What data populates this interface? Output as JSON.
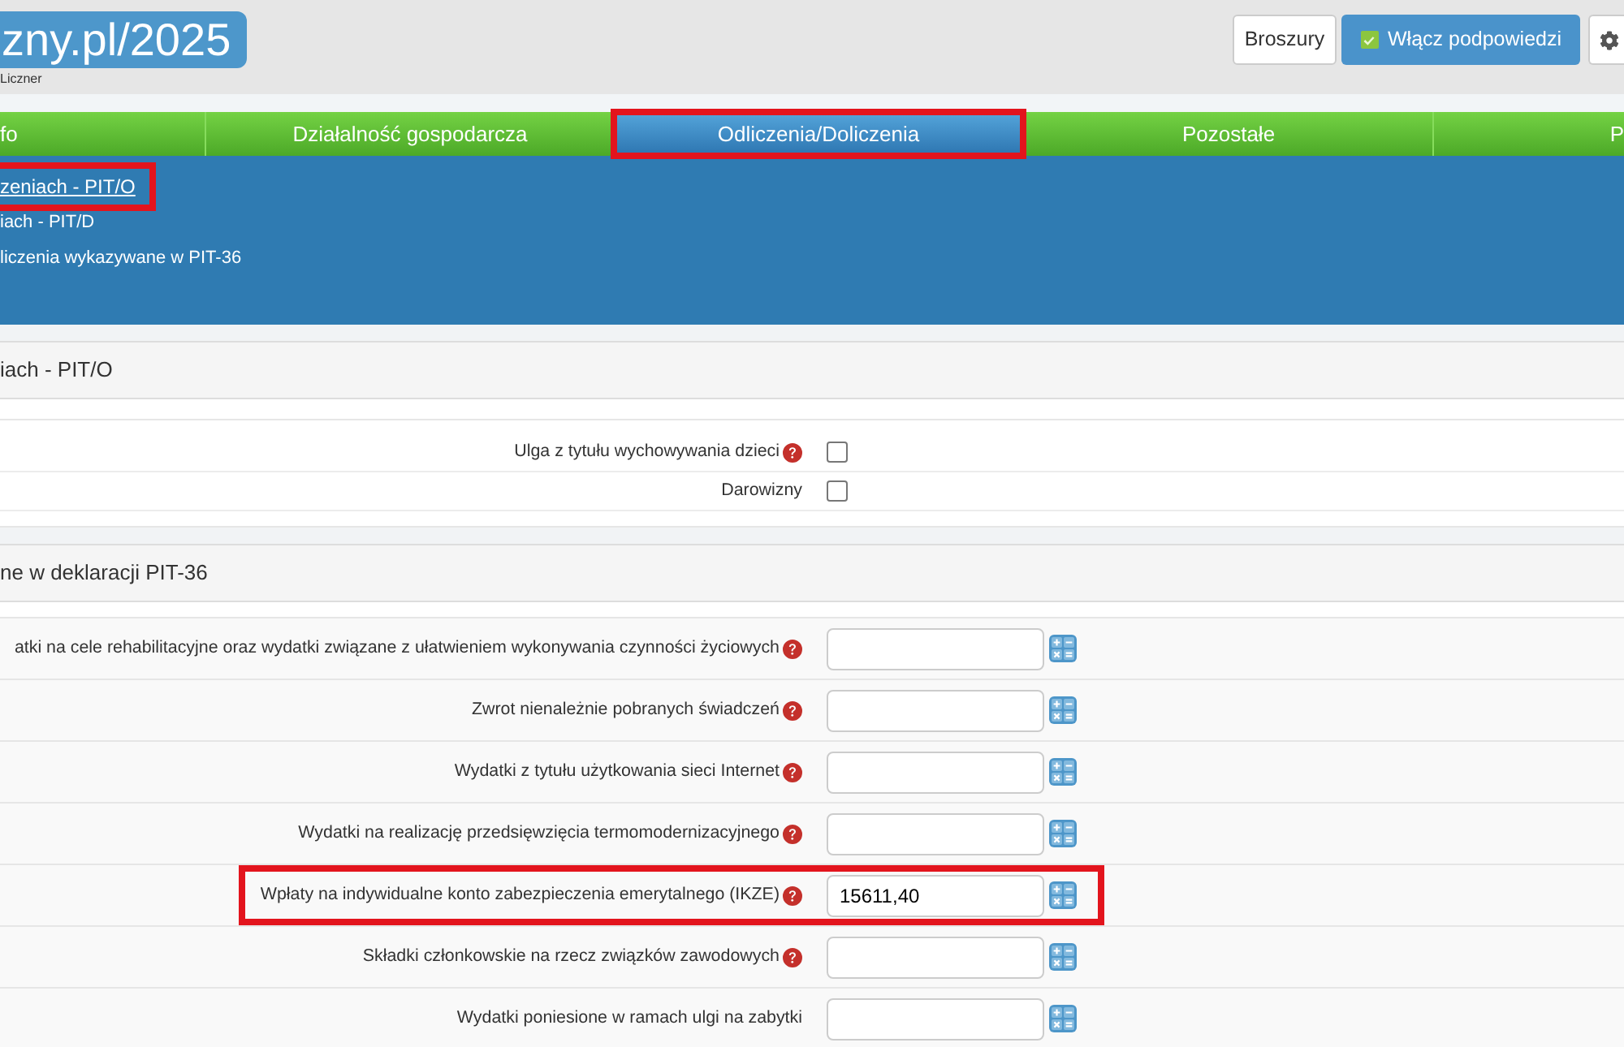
{
  "header": {
    "logo": "zny.pl/2025",
    "tagline": "Liczner",
    "buttons": [
      {
        "kind": "plain",
        "label": "Broszury"
      },
      {
        "kind": "toggle",
        "label": "Włącz podpowiedzi",
        "checked": true
      },
      {
        "kind": "settings"
      }
    ]
  },
  "tabs": [
    {
      "label": "fo",
      "selected": false,
      "highlighted": false
    },
    {
      "label": "Działalność gospodarcza",
      "selected": false,
      "highlighted": false
    },
    {
      "label": "Odliczenia/Doliczenia",
      "selected": true,
      "highlighted": true
    },
    {
      "label": "Pozostałe",
      "selected": false,
      "highlighted": false
    },
    {
      "label": "P",
      "selected": false,
      "highlighted": false
    }
  ],
  "subnav": [
    {
      "label": "zeniach - PIT/O",
      "selected": true,
      "highlighted": true
    },
    {
      "label": "iach - PIT/D",
      "selected": false,
      "highlighted": false
    },
    {
      "label": "liczenia wykazywane w PIT-36",
      "selected": false,
      "highlighted": false
    }
  ],
  "sections": [
    {
      "title": "iach - PIT/O",
      "rows": [
        {
          "kind": "checkbox",
          "label": "Ulga z tytułu wychowywania dzieci",
          "help": true,
          "checked": false,
          "highlighted": false
        },
        {
          "kind": "checkbox",
          "label": "Darowizny",
          "help": false,
          "checked": false,
          "highlighted": false
        }
      ]
    },
    {
      "title": "ne w deklaracji PIT-36",
      "rows": [
        {
          "kind": "amount",
          "label": "atki na cele rehabilitacyjne oraz wydatki związane z ułatwieniem wykonywania czynności życiowych",
          "help": true,
          "highlighted": false
        },
        {
          "kind": "amount",
          "label": "Zwrot nienależnie pobranych świadczeń",
          "help": true,
          "highlighted": false
        },
        {
          "kind": "amount",
          "label": "Wydatki z tytułu użytkowania sieci Internet",
          "help": true,
          "highlighted": false
        },
        {
          "kind": "amount",
          "label": "Wydatki na realizację przedsięwzięcia termomodernizacyjnego",
          "help": true,
          "highlighted": false
        },
        {
          "kind": "amount",
          "label": "Wpłaty na indywidualne konto zabezpieczenia emerytalnego (IKZE)",
          "help": true,
          "value": "15611,40",
          "highlighted": true
        },
        {
          "kind": "amount",
          "label": "Składki członkowskie na rzecz związków zawodowych",
          "help": true,
          "highlighted": false
        },
        {
          "kind": "amount",
          "label": "Wydatki poniesione w ramach ulgi na zabytki",
          "help": false,
          "highlighted": false
        }
      ]
    }
  ]
}
